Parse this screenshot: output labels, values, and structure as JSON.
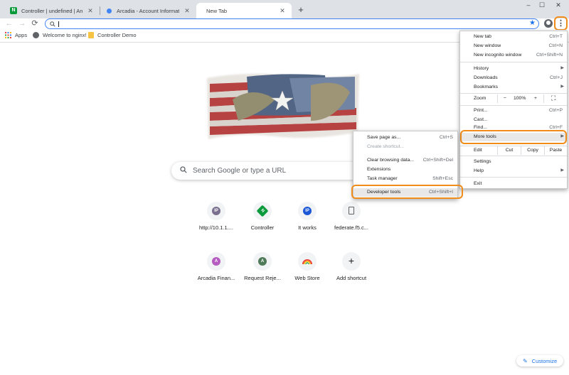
{
  "tabs": [
    {
      "title": "Controller | undefined | Analytics",
      "favicon": "nginx-icon"
    },
    {
      "title": "Arcadia - Account Information",
      "favicon": "circle-icon"
    },
    {
      "title": "New Tab",
      "favicon": ""
    }
  ],
  "window_controls": {
    "minimize": "–",
    "maximize": "☐",
    "close": "✕"
  },
  "toolbar": {
    "back": "←",
    "forward": "→",
    "reload": "⟳",
    "star": "★",
    "menu": "⋮",
    "lens": "🔍"
  },
  "bookmarks": [
    {
      "label": "Apps",
      "icon": "apps-grid-icon"
    },
    {
      "label": "Welcome to nginx!",
      "icon": "globe-icon"
    },
    {
      "label": "Controller Demo",
      "icon": "folder-icon"
    }
  ],
  "search": {
    "placeholder": "Search Google or type a URL"
  },
  "shortcuts": [
    {
      "label": "http://10.1.1....",
      "letter": "IP",
      "color": "#7b6f8f"
    },
    {
      "label": "Controller",
      "letter": "N",
      "color": "#0b9a3c"
    },
    {
      "label": "It works",
      "letter": "IP",
      "color": "#1a56d6"
    },
    {
      "label": "federate.f5.c...",
      "letter": "",
      "color": "#5f6368"
    },
    {
      "label": "Arcadia Finan...",
      "letter": "A",
      "color": "#b45cc0"
    },
    {
      "label": "Request Reje...",
      "letter": "A",
      "color": "#4f7a5a"
    },
    {
      "label": "Web Store",
      "letter": "",
      "color": "#ea4335"
    },
    {
      "label": "Add shortcut",
      "letter": "+",
      "color": "#202124"
    }
  ],
  "customize": {
    "label": "Customize"
  },
  "menu": {
    "new_tab": {
      "label": "New tab",
      "shortcut": "Ctrl+T"
    },
    "new_window": {
      "label": "New window",
      "shortcut": "Ctrl+N"
    },
    "incognito": {
      "label": "New incognito window",
      "shortcut": "Ctrl+Shift+N"
    },
    "history": {
      "label": "History"
    },
    "downloads": {
      "label": "Downloads",
      "shortcut": "Ctrl+J"
    },
    "bookmarks": {
      "label": "Bookmarks"
    },
    "zoom": {
      "label": "Zoom",
      "minus": "−",
      "value": "100%",
      "plus": "+",
      "fullscreen": "⛶"
    },
    "print": {
      "label": "Print...",
      "shortcut": "Ctrl+P"
    },
    "cast": {
      "label": "Cast..."
    },
    "find": {
      "label": "Find...",
      "shortcut": "Ctrl+F"
    },
    "more_tools": {
      "label": "More tools"
    },
    "edit": {
      "label": "Edit",
      "cut": "Cut",
      "copy": "Copy",
      "paste": "Paste"
    },
    "settings": {
      "label": "Settings"
    },
    "help": {
      "label": "Help"
    },
    "exit": {
      "label": "Exit"
    }
  },
  "submenu": {
    "save_page": {
      "label": "Save page as...",
      "shortcut": "Ctrl+S"
    },
    "create_shortcut": {
      "label": "Create shortcut..."
    },
    "clear_data": {
      "label": "Clear browsing data...",
      "shortcut": "Ctrl+Shift+Del"
    },
    "extensions": {
      "label": "Extensions"
    },
    "task_manager": {
      "label": "Task manager",
      "shortcut": "Shift+Esc"
    },
    "developer_tools": {
      "label": "Developer tools",
      "shortcut": "Ctrl+Shift+I"
    }
  },
  "colors": {
    "highlight": "#f08c1a",
    "accent": "#1a73e8",
    "tabstrip": "#dee1e6"
  }
}
